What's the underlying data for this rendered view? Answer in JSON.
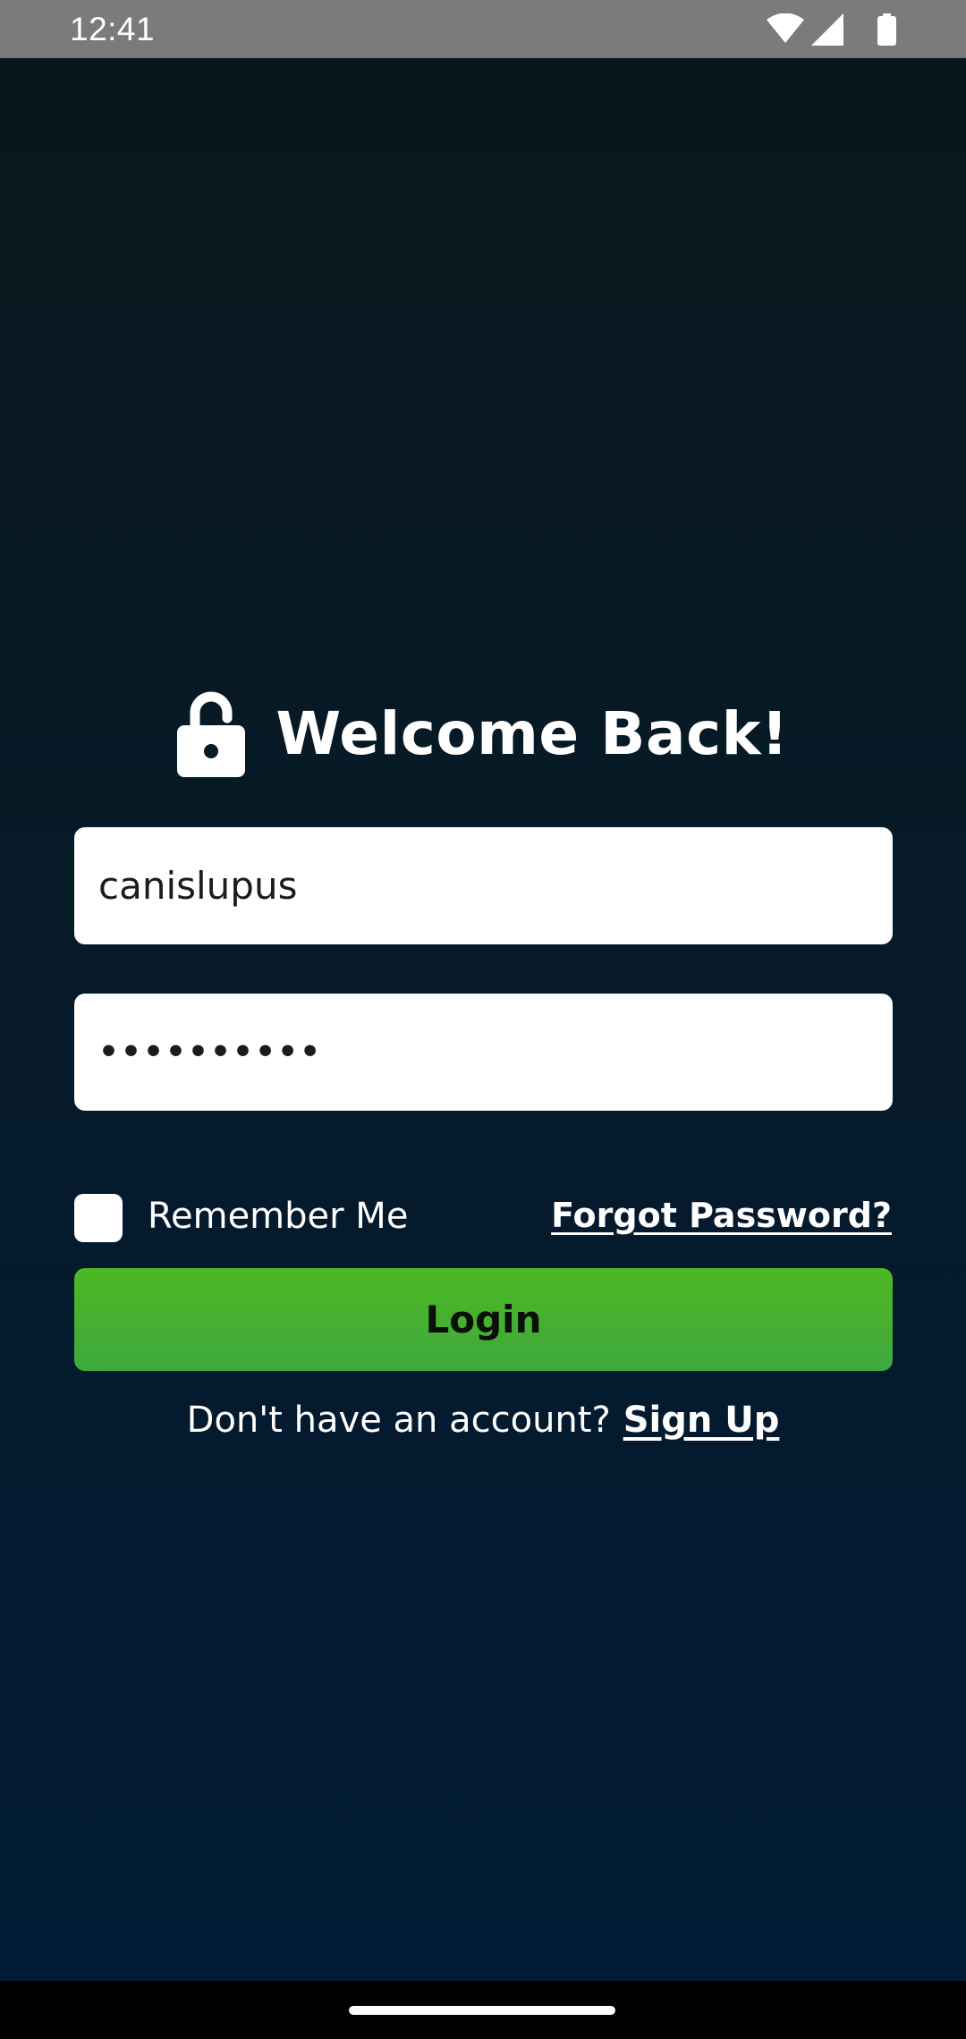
{
  "status_bar": {
    "time": "12:41",
    "icons": [
      "wifi-icon",
      "signal-icon",
      "battery-icon"
    ]
  },
  "login": {
    "title": "Welcome Back!",
    "title_icon": "lock-open-icon",
    "username_value": "canislupus",
    "password_mask": "••••••••••",
    "remember_label": "Remember Me",
    "remember_checked": false,
    "forgot_label": "Forgot Password?",
    "login_label": "Login",
    "signup_prompt": "Don't have an account?",
    "signup_label": "Sign Up"
  },
  "colors": {
    "background_top": "#09171c",
    "background_bottom": "#021b36",
    "accent_green": "#4cb822",
    "text": "#ffffff"
  }
}
